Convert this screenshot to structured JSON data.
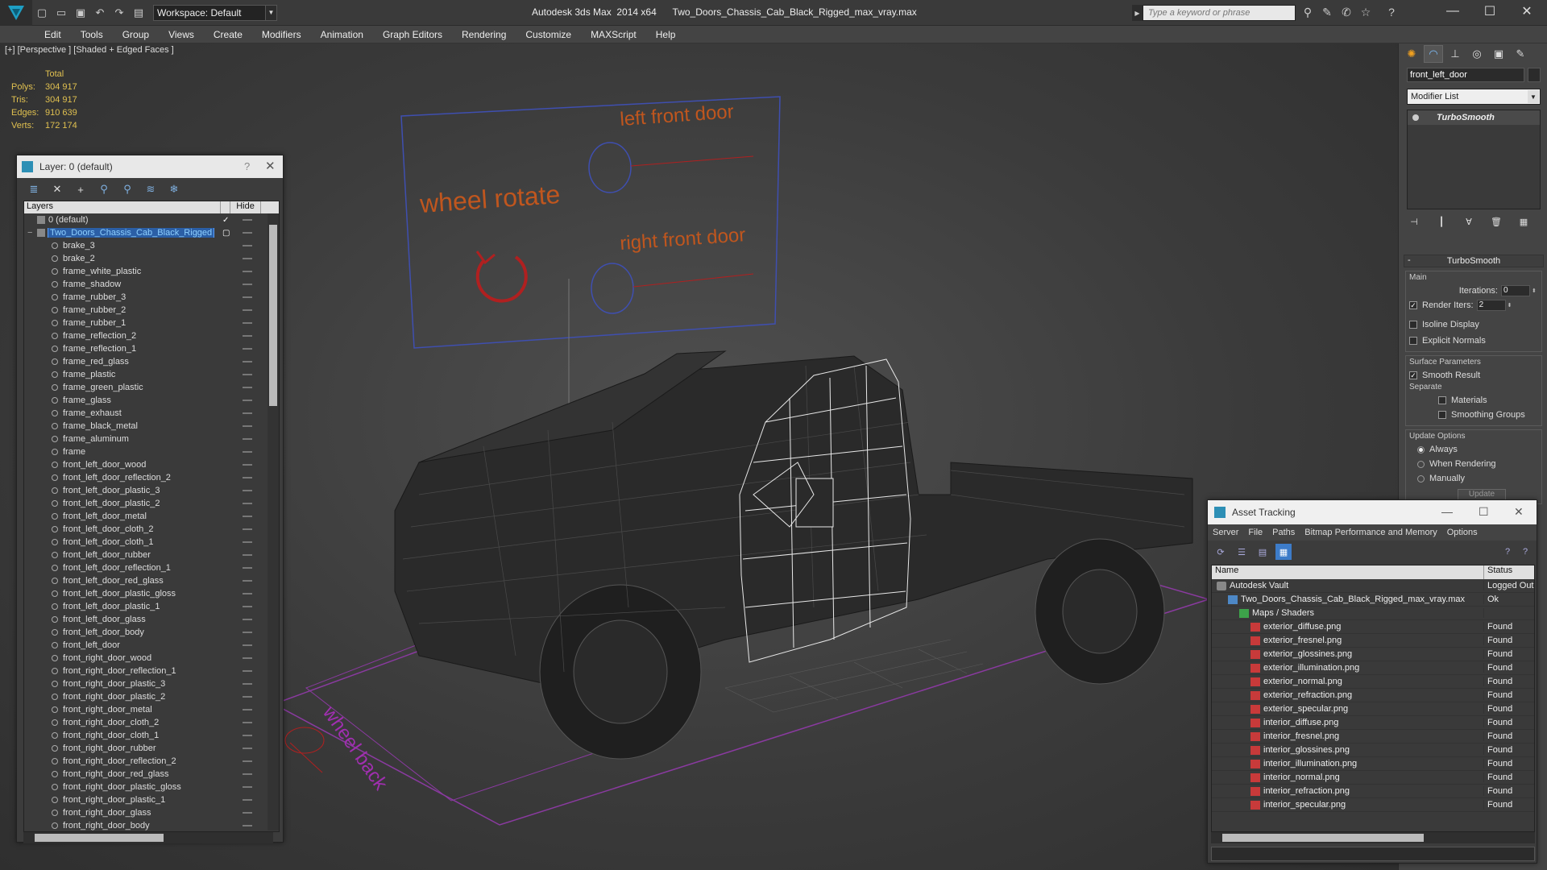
{
  "window": {
    "title": "Autodesk 3ds Max  2014 x64      Two_Doors_Chassis_Cab_Black_Rigged_max_vray.max",
    "workspace": "Workspace: Default",
    "search_placeholder": "Type a keyword or phrase"
  },
  "menu": [
    "Edit",
    "Tools",
    "Group",
    "Views",
    "Create",
    "Modifiers",
    "Animation",
    "Graph Editors",
    "Rendering",
    "Customize",
    "MAXScript",
    "Help"
  ],
  "viewport": {
    "label": "[+] [Perspective ] [Shaded + Edged Faces ]",
    "stats": {
      "header": "Total",
      "rows": [
        {
          "k": "Polys:",
          "v": "304 917"
        },
        {
          "k": "Tris:",
          "v": "304 917"
        },
        {
          "k": "Edges:",
          "v": "910 639"
        },
        {
          "k": "Verts:",
          "v": "172 174"
        }
      ]
    },
    "annotations": {
      "left_front_door": "left front door",
      "right_front_door": "right front door",
      "wheel_rotate": "wheel rotate",
      "wheel_back": "wheel back"
    }
  },
  "layer_panel": {
    "title": "Layer: 0 (default)",
    "help": "?",
    "col_layers": "Layers",
    "col_hide": "Hide",
    "layers": [
      {
        "name": "0 (default)",
        "type": "layer",
        "checked": true
      },
      {
        "name": "Two_Doors_Chassis_Cab_Black_Rigged",
        "type": "layer",
        "selected": true
      }
    ],
    "objects": [
      "brake_3",
      "brake_2",
      "frame_white_plastic",
      "frame_shadow",
      "frame_rubber_3",
      "frame_rubber_2",
      "frame_rubber_1",
      "frame_reflection_2",
      "frame_reflection_1",
      "frame_red_glass",
      "frame_plastic",
      "frame_green_plastic",
      "frame_glass",
      "frame_exhaust",
      "frame_black_metal",
      "frame_aluminum",
      "frame",
      "front_left_door_wood",
      "front_left_door_reflection_2",
      "front_left_door_plastic_3",
      "front_left_door_plastic_2",
      "front_left_door_metal",
      "front_left_door_cloth_2",
      "front_left_door_cloth_1",
      "front_left_door_rubber",
      "front_left_door_reflection_1",
      "front_left_door_red_glass",
      "front_left_door_plastic_gloss",
      "front_left_door_plastic_1",
      "front_left_door_glass",
      "front_left_door_body",
      "front_left_door",
      "front_right_door_wood",
      "front_right_door_reflection_1",
      "front_right_door_plastic_3",
      "front_right_door_plastic_2",
      "front_right_door_metal",
      "front_right_door_cloth_2",
      "front_right_door_cloth_1",
      "front_right_door_rubber",
      "front_right_door_reflection_2",
      "front_right_door_red_glass",
      "front_right_door_plastic_gloss",
      "front_right_door_plastic_1",
      "front_right_door_glass",
      "front_right_door_body"
    ]
  },
  "command_panel": {
    "object_name": "front_left_door",
    "modifier_list": "Modifier List",
    "stack_entry": "TurboSmooth",
    "rollout_title": "TurboSmooth",
    "main_label": "Main",
    "iterations_label": "Iterations:",
    "iterations_value": "0",
    "render_iters_label": "Render Iters:",
    "render_iters_value": "2",
    "isoline_display": "Isoline Display",
    "explicit_normals": "Explicit Normals",
    "surface_params": "Surface Parameters",
    "smooth_result": "Smooth Result",
    "separate": "Separate",
    "materials": "Materials",
    "smoothing_groups": "Smoothing Groups",
    "update_options": "Update Options",
    "always": "Always",
    "when_rendering": "When Rendering",
    "manually": "Manually",
    "update_btn": "Update"
  },
  "asset_panel": {
    "title": "Asset Tracking",
    "menu": [
      "Server",
      "File",
      "Paths",
      "Bitmap Performance and Memory",
      "Options"
    ],
    "col_name": "Name",
    "col_status": "Status",
    "rows": [
      {
        "name": "Autodesk Vault",
        "status": "Logged Out",
        "icon": "vault",
        "indent": 1
      },
      {
        "name": "Two_Doors_Chassis_Cab_Black_Rigged_max_vray.max",
        "status": "Ok",
        "icon": "file",
        "indent": 2
      },
      {
        "name": "Maps / Shaders",
        "status": "",
        "icon": "folder",
        "indent": 3
      },
      {
        "name": "exterior_diffuse.png",
        "status": "Found",
        "icon": "png",
        "indent": 4
      },
      {
        "name": "exterior_fresnel.png",
        "status": "Found",
        "icon": "png",
        "indent": 4
      },
      {
        "name": "exterior_glossines.png",
        "status": "Found",
        "icon": "png",
        "indent": 4
      },
      {
        "name": "exterior_illumination.png",
        "status": "Found",
        "icon": "png",
        "indent": 4
      },
      {
        "name": "exterior_normal.png",
        "status": "Found",
        "icon": "png",
        "indent": 4
      },
      {
        "name": "exterior_refraction.png",
        "status": "Found",
        "icon": "png",
        "indent": 4
      },
      {
        "name": "exterior_specular.png",
        "status": "Found",
        "icon": "png",
        "indent": 4
      },
      {
        "name": "interior_diffuse.png",
        "status": "Found",
        "icon": "png",
        "indent": 4
      },
      {
        "name": "interior_fresnel.png",
        "status": "Found",
        "icon": "png",
        "indent": 4
      },
      {
        "name": "interior_glossines.png",
        "status": "Found",
        "icon": "png",
        "indent": 4
      },
      {
        "name": "interior_illumination.png",
        "status": "Found",
        "icon": "png",
        "indent": 4
      },
      {
        "name": "interior_normal.png",
        "status": "Found",
        "icon": "png",
        "indent": 4
      },
      {
        "name": "interior_refraction.png",
        "status": "Found",
        "icon": "png",
        "indent": 4
      },
      {
        "name": "interior_specular.png",
        "status": "Found",
        "icon": "png",
        "indent": 4
      }
    ]
  },
  "colors": {
    "annotation_text": "#c0561e",
    "stats_text": "#e0c050",
    "selection": "#2b5fa6",
    "helper_line": "#8a3aa0"
  }
}
